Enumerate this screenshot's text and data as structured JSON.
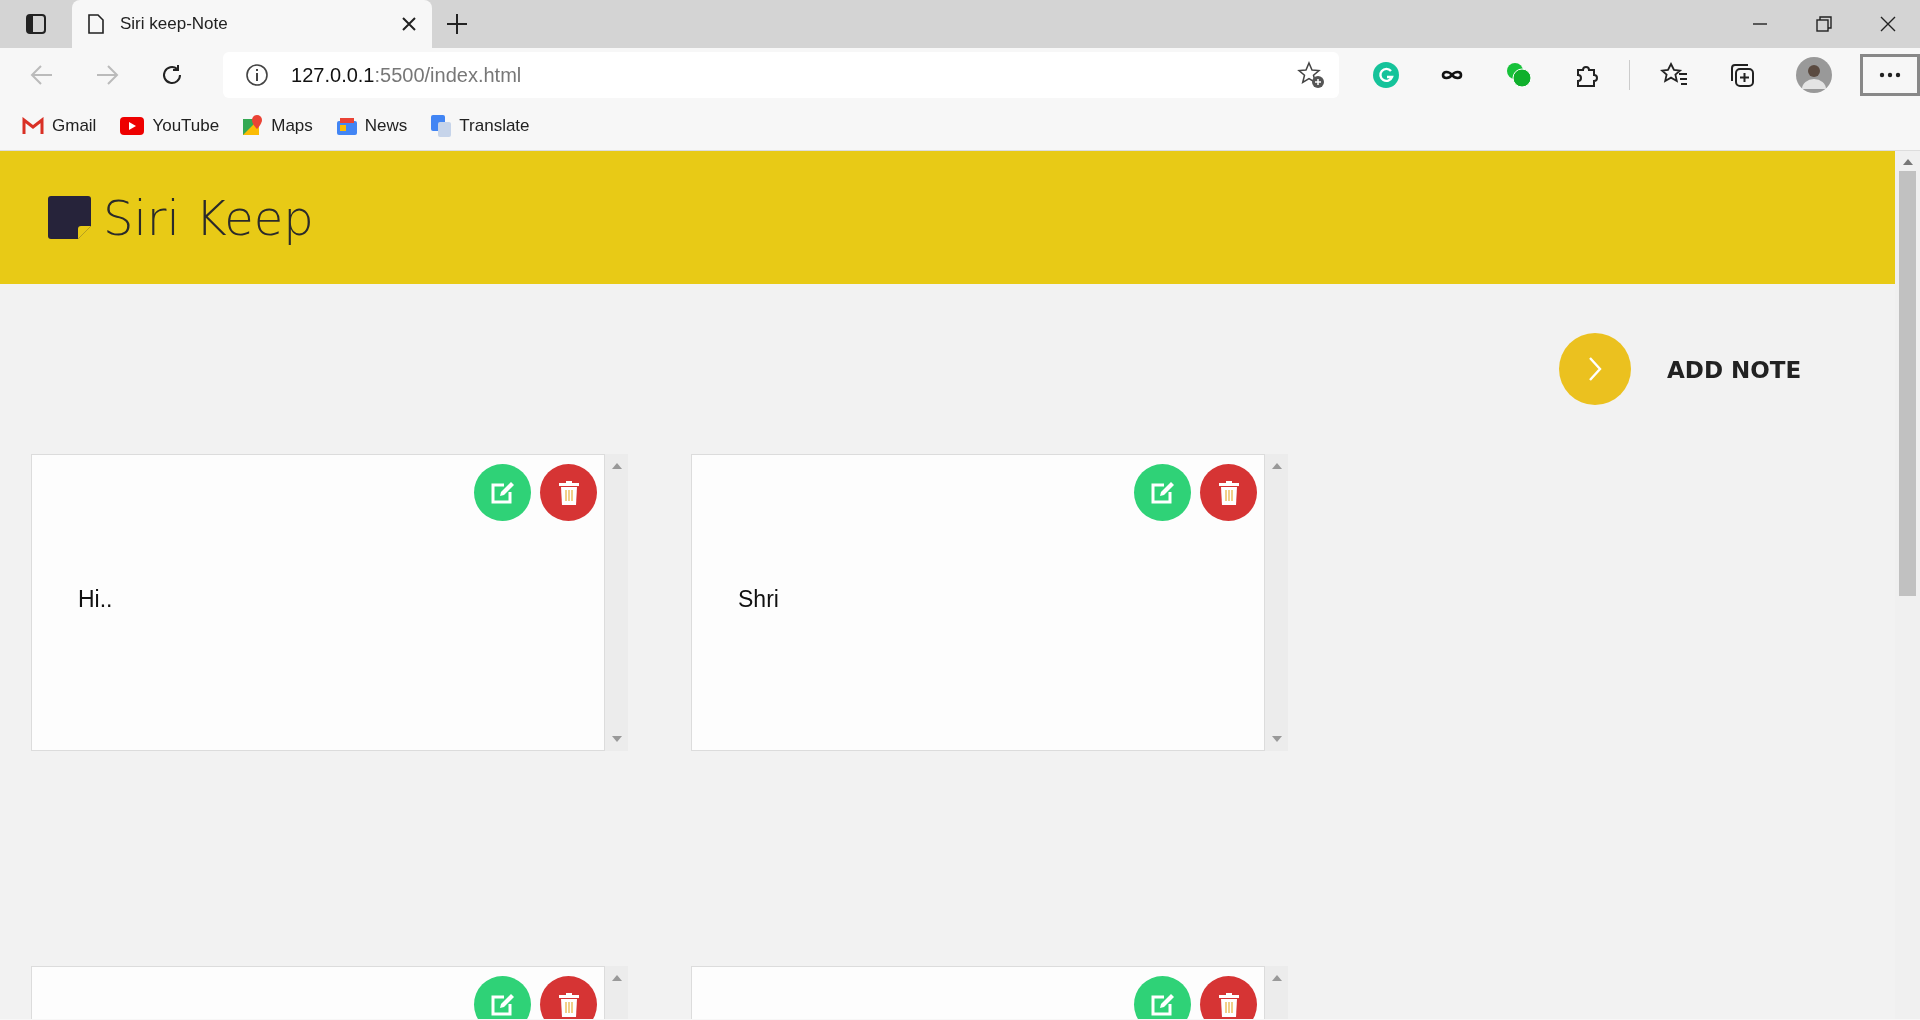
{
  "browser": {
    "tab": {
      "title": "Siri keep-Note"
    },
    "address": {
      "host": "127.0.0.1",
      "path": ":5500/index.html"
    },
    "bookmarks": [
      {
        "label": "Gmail",
        "kind": "gmail"
      },
      {
        "label": "YouTube",
        "kind": "youtube"
      },
      {
        "label": "Maps",
        "kind": "maps"
      },
      {
        "label": "News",
        "kind": "news"
      },
      {
        "label": "Translate",
        "kind": "translate"
      }
    ]
  },
  "app": {
    "title": "Siri Keep",
    "add_button": {
      "label": "ADD NOTE"
    },
    "notes": [
      {
        "kind": "note",
        "text": "Hi.."
      },
      {
        "kind": "note",
        "text": "Shri"
      },
      {
        "kind": "note"
      },
      {
        "kind": "note"
      }
    ]
  }
}
